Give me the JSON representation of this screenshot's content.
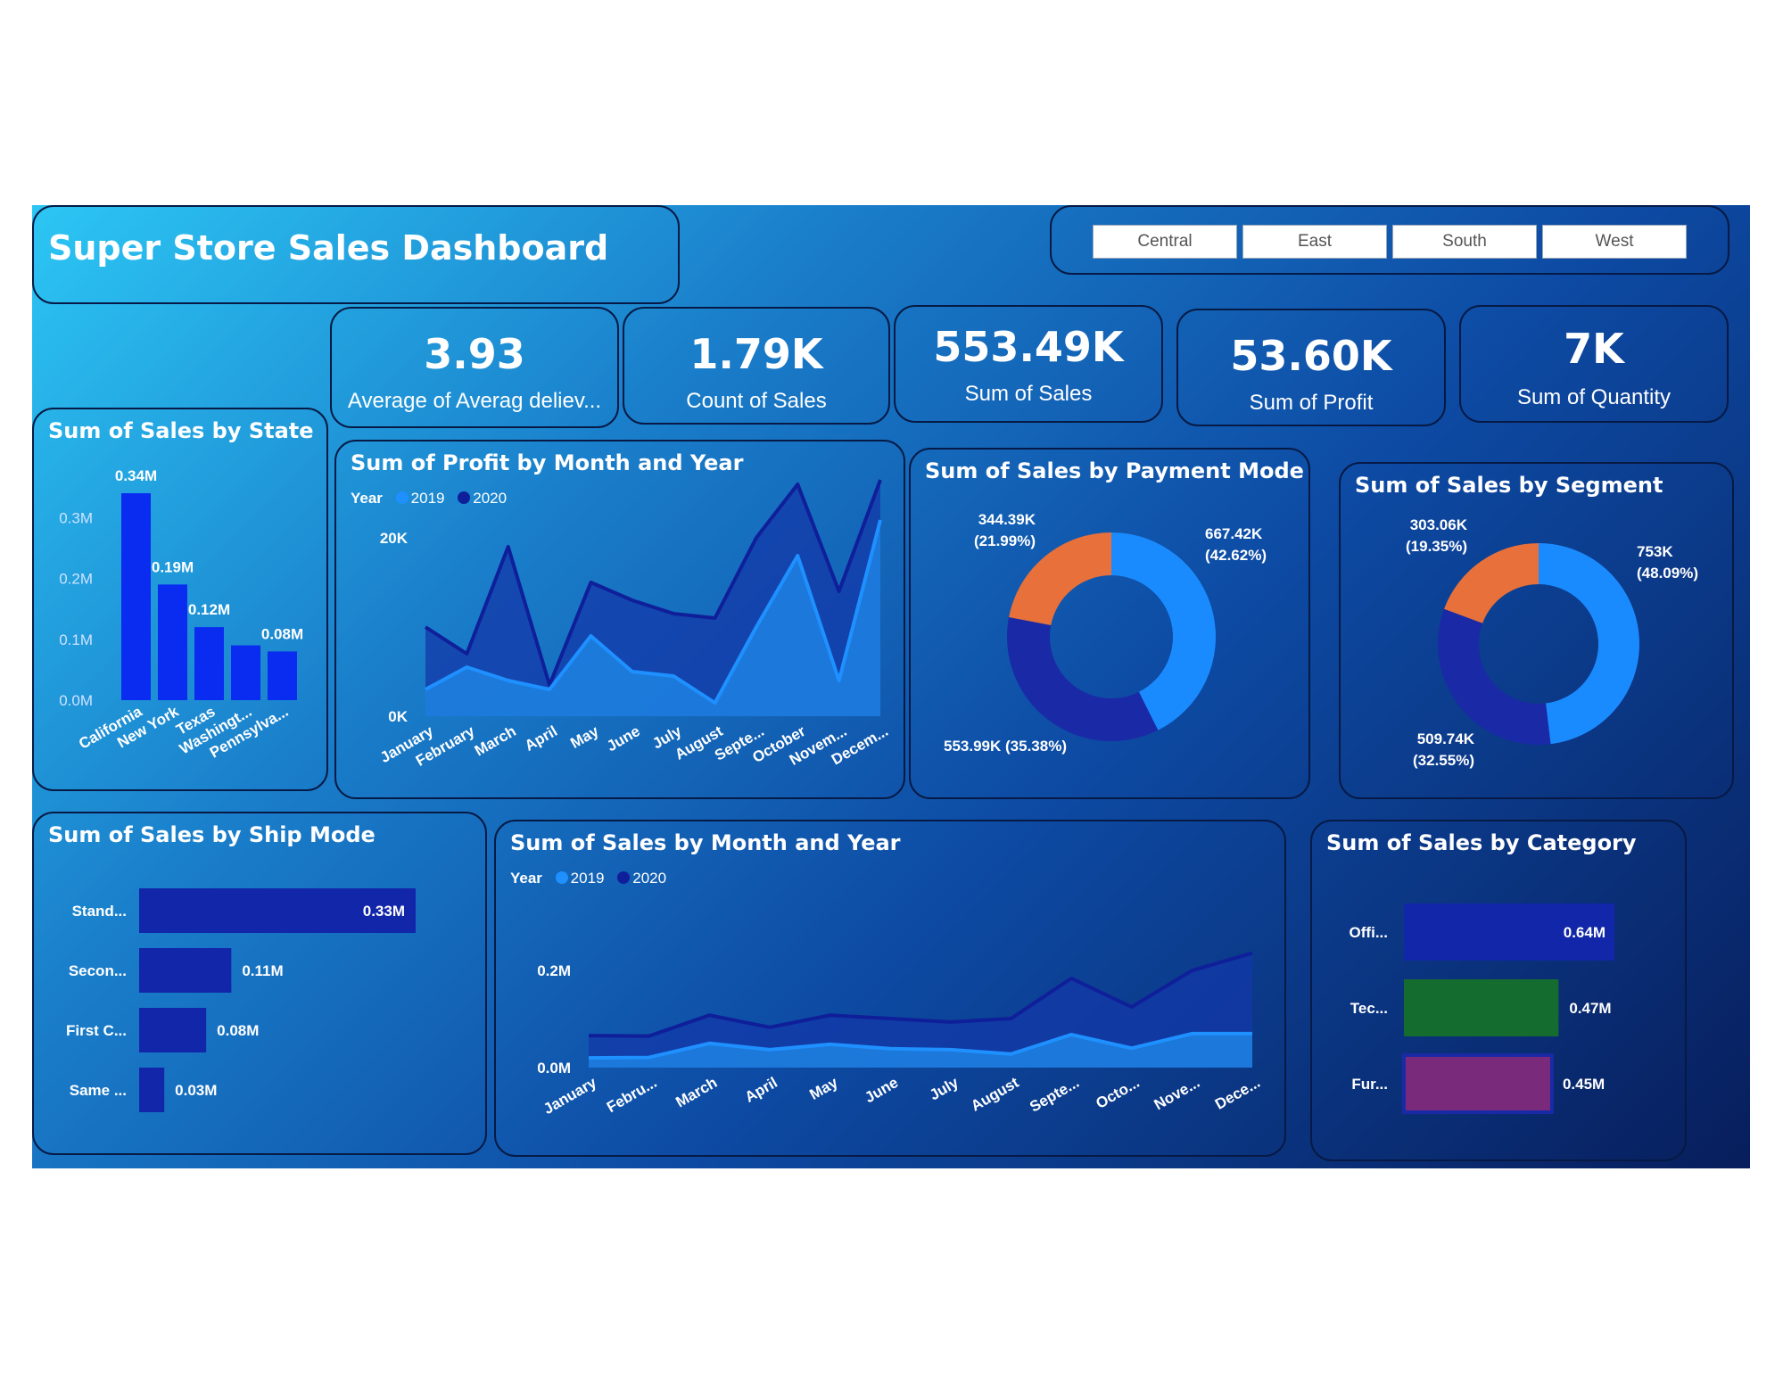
{
  "header": {
    "title": "Super Store Sales Dashboard"
  },
  "slicer": {
    "regions": [
      "Central",
      "East",
      "South",
      "West"
    ]
  },
  "kpis": [
    {
      "value": "3.93",
      "label": "Average of Averag deliev..."
    },
    {
      "value": "1.79K",
      "label": "Count of Sales"
    },
    {
      "value": "553.49K",
      "label": "Sum of Sales"
    },
    {
      "value": "53.60K",
      "label": "Sum of Profit"
    },
    {
      "value": "7K",
      "label": "Sum of Quantity"
    }
  ],
  "colors": {
    "series_2019": "#1e90ff",
    "series_2020": "#0f1f99",
    "bar_blue": "#0a2cf0",
    "bar_navy": "#1126a8",
    "orange": "#e8703a",
    "green": "#146c2e",
    "purple": "#7a2a7a"
  },
  "chart_data": [
    {
      "id": "state",
      "type": "bar",
      "title": "Sum of Sales by State",
      "categories": [
        "California",
        "New York",
        "Texas",
        "Washingt...",
        "Pennsylva..."
      ],
      "values": [
        0.34,
        0.19,
        0.12,
        0.09,
        0.08
      ],
      "data_labels": [
        "0.34M",
        "0.19M",
        "0.12M",
        "",
        "0.08M"
      ],
      "yticks": [
        "0.0M",
        "0.1M",
        "0.2M",
        "0.3M"
      ],
      "ylim": [
        0,
        0.34
      ]
    },
    {
      "id": "profit_month",
      "type": "area",
      "title": "Sum of Profit by Month and Year",
      "legend_title": "Year",
      "categories": [
        "January",
        "February",
        "March",
        "April",
        "May",
        "June",
        "July",
        "August",
        "Septe...",
        "October",
        "Novem...",
        "Decem..."
      ],
      "series": [
        {
          "name": "2019",
          "values": [
            3000,
            5500,
            4000,
            3000,
            9000,
            5000,
            4500,
            1500,
            10000,
            18000,
            4000,
            22000
          ]
        },
        {
          "name": "2020",
          "values": [
            10000,
            7000,
            19000,
            3500,
            15000,
            13000,
            11500,
            11000,
            20000,
            26000,
            14000,
            26500
          ]
        }
      ],
      "yticks": [
        "0K",
        "20K"
      ],
      "ylim": [
        0,
        30000
      ]
    },
    {
      "id": "payment",
      "type": "pie",
      "title": "Sum of Sales by Payment Mode",
      "values": [
        42.62,
        35.38,
        21.99
      ],
      "labels": [
        "667.42K\n(42.62%)",
        "553.99K (35.38%)",
        "344.39K\n(21.99%)"
      ]
    },
    {
      "id": "segment",
      "type": "pie",
      "title": "Sum of Sales by Segment",
      "values": [
        48.09,
        32.55,
        19.35
      ],
      "labels": [
        "753K\n(48.09%)",
        "509.74K\n(32.55%)",
        "303.06K\n(19.35%)"
      ]
    },
    {
      "id": "shipmode",
      "type": "bar",
      "title": "Sum of Sales by Ship Mode",
      "categories": [
        "Stand...",
        "Secon...",
        "First C...",
        "Same ..."
      ],
      "values": [
        0.33,
        0.11,
        0.08,
        0.03
      ],
      "data_labels": [
        "0.33M",
        "0.11M",
        "0.08M",
        "0.03M"
      ]
    },
    {
      "id": "sales_month",
      "type": "area",
      "title": "Sum of Sales by Month and Year",
      "legend_title": "Year",
      "categories": [
        "January",
        "Febru...",
        "March",
        "April",
        "May",
        "June",
        "July",
        "August",
        "Septe...",
        "Octo...",
        "Nove...",
        "Dece..."
      ],
      "series": [
        {
          "name": "2019",
          "values": [
            0.02,
            0.021,
            0.05,
            0.037,
            0.048,
            0.039,
            0.037,
            0.028,
            0.068,
            0.04,
            0.07,
            0.07
          ]
        },
        {
          "name": "2020",
          "values": [
            0.066,
            0.065,
            0.108,
            0.083,
            0.108,
            0.101,
            0.094,
            0.101,
            0.184,
            0.125,
            0.2,
            0.236
          ]
        }
      ],
      "yticks": [
        "0.0M",
        "0.2M"
      ],
      "ylim": [
        0,
        0.25
      ]
    },
    {
      "id": "category",
      "type": "bar",
      "title": "Sum of Sales by Category",
      "categories": [
        "Offi...",
        "Tec...",
        "Fur..."
      ],
      "values": [
        0.64,
        0.47,
        0.45
      ],
      "data_labels": [
        "0.64M",
        "0.47M",
        "0.45M"
      ]
    }
  ]
}
